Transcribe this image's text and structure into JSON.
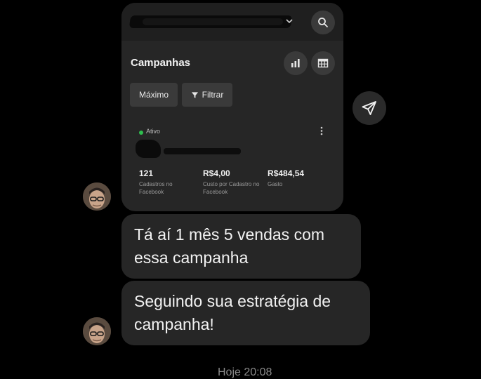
{
  "post_card": {
    "title": "Campanhas",
    "buttons": {
      "maximo": "Máximo",
      "filtrar": "Filtrar"
    },
    "status": "Ativo",
    "metrics": [
      {
        "value": "121",
        "label": "Cadastros no Facebook"
      },
      {
        "value": "R$4,00",
        "label": "Custo por Cadastro no Facebook"
      },
      {
        "value": "R$484,54",
        "label": "Gasto"
      }
    ],
    "icons": [
      "search-icon",
      "bar-chart-icon",
      "table-icon",
      "filter-icon",
      "more-vertical-icon",
      "chevron-down-icon"
    ]
  },
  "messages": [
    {
      "text": "Tá aí 1 mês 5 vendas com\nessa campanha"
    },
    {
      "text": "Seguindo sua estratégia de\ncampanha!"
    }
  ],
  "timestamp": "Hoje 20:08",
  "colors": {
    "background": "#000000",
    "bubble": "#262626",
    "status_active": "#2fbf4f"
  }
}
